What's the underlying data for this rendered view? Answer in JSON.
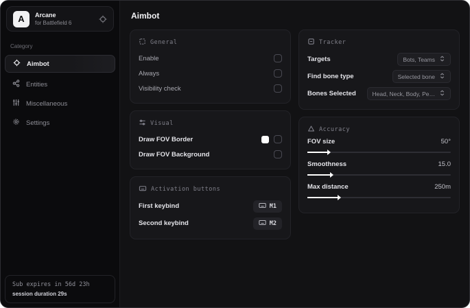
{
  "app": {
    "initial": "A",
    "name": "Arcane",
    "subtitle": "for Battlefield 6"
  },
  "sidebar": {
    "category_label": "Category",
    "items": [
      {
        "label": "Aimbot"
      },
      {
        "label": "Entities"
      },
      {
        "label": "Miscellaneous"
      },
      {
        "label": "Settings"
      }
    ],
    "subscription": {
      "expires": "Sub expires in 56d 23h",
      "session": "session duration 29s"
    }
  },
  "main": {
    "title": "Aimbot",
    "general": {
      "title": "General",
      "rows": [
        {
          "label": "Enable",
          "checked": false
        },
        {
          "label": "Always",
          "checked": false
        },
        {
          "label": "Visibility check",
          "checked": false
        }
      ]
    },
    "visual": {
      "title": "Visual",
      "rows": [
        {
          "label": "Draw FOV Border",
          "swatch": "#ffffff",
          "checked": false
        },
        {
          "label": "Draw FOV Background",
          "checked": false
        }
      ]
    },
    "activation": {
      "title": "Activation buttons",
      "rows": [
        {
          "label": "First keybind",
          "key": "M1"
        },
        {
          "label": "Second keybind",
          "key": "M2"
        }
      ]
    },
    "tracker": {
      "title": "Tracker",
      "rows": [
        {
          "label": "Targets",
          "value": "Bots, Teams"
        },
        {
          "label": "Find bone type",
          "value": "Selected bone"
        },
        {
          "label": "Bones Selected",
          "value": "Head, Neck, Body, Pe…"
        }
      ]
    },
    "accuracy": {
      "title": "Accuracy",
      "rows": [
        {
          "label": "FOV size",
          "value": "50°",
          "fill": "14%"
        },
        {
          "label": "Smoothness",
          "value": "15.0",
          "fill": "16%"
        },
        {
          "label": "Max distance",
          "value": "250m",
          "fill": "21%"
        }
      ]
    }
  },
  "colors": {
    "accent": "#ffffff",
    "card_bg": "#17171a",
    "sidebar_bg": "#0b0b0d"
  }
}
